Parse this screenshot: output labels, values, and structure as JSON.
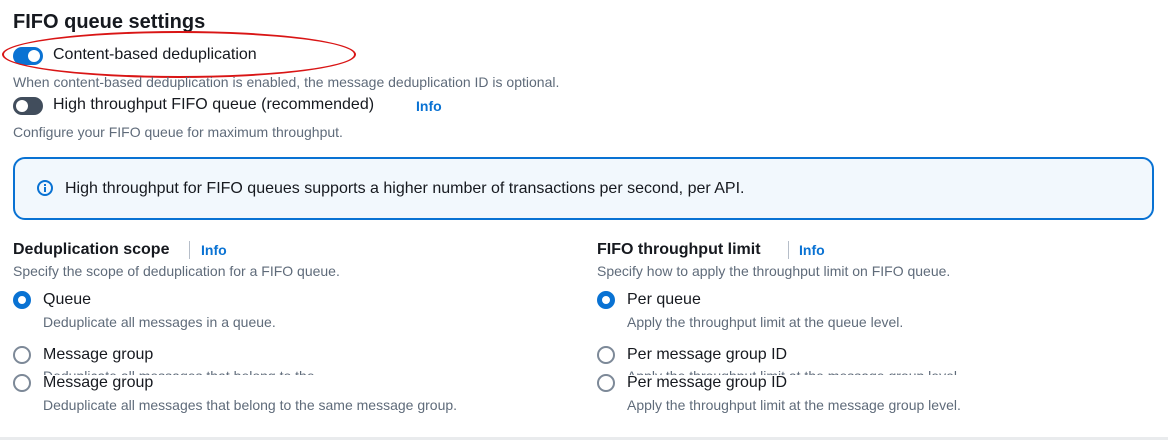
{
  "section_title": "FIFO queue settings",
  "content_dedup": {
    "label": "Content-based deduplication",
    "enabled": true,
    "description": "When content-based deduplication is enabled, the message deduplication ID is optional."
  },
  "high_throughput": {
    "label": "High throughput FIFO queue (recommended)",
    "info": "Info",
    "enabled": false,
    "description": "Configure your FIFO queue for maximum throughput."
  },
  "alert": {
    "icon": "info-circle-icon",
    "text": "High throughput for FIFO queues supports a higher number of transactions per second, per API."
  },
  "dedup_scope": {
    "heading": "Deduplication scope",
    "info": "Info",
    "description": "Specify the scope of deduplication for a FIFO queue.",
    "options": [
      {
        "label": "Queue",
        "description": "Deduplicate all messages in a queue.",
        "checked": true
      },
      {
        "label": "Message group",
        "description": "Deduplicate all messages that belong to the",
        "checked": false
      },
      {
        "label": "Message group",
        "description": "Deduplicate all messages that belong to the same message group.",
        "checked": false
      }
    ]
  },
  "throughput_limit": {
    "heading": "FIFO throughput limit",
    "info": "Info",
    "description": "Specify how to apply the throughput limit on FIFO queue.",
    "options": [
      {
        "label": "Per queue",
        "description": "Apply the throughput limit at the queue level.",
        "checked": true
      },
      {
        "label": "Per message group ID",
        "description": "Apply the throughput limit at the message group level",
        "checked": false
      },
      {
        "label": "Per message group ID",
        "description": "Apply the throughput limit at the message group level.",
        "checked": false
      }
    ]
  },
  "colors": {
    "accent": "#0972d3",
    "highlight": "#d91515",
    "text_secondary": "#5f6b7a"
  }
}
